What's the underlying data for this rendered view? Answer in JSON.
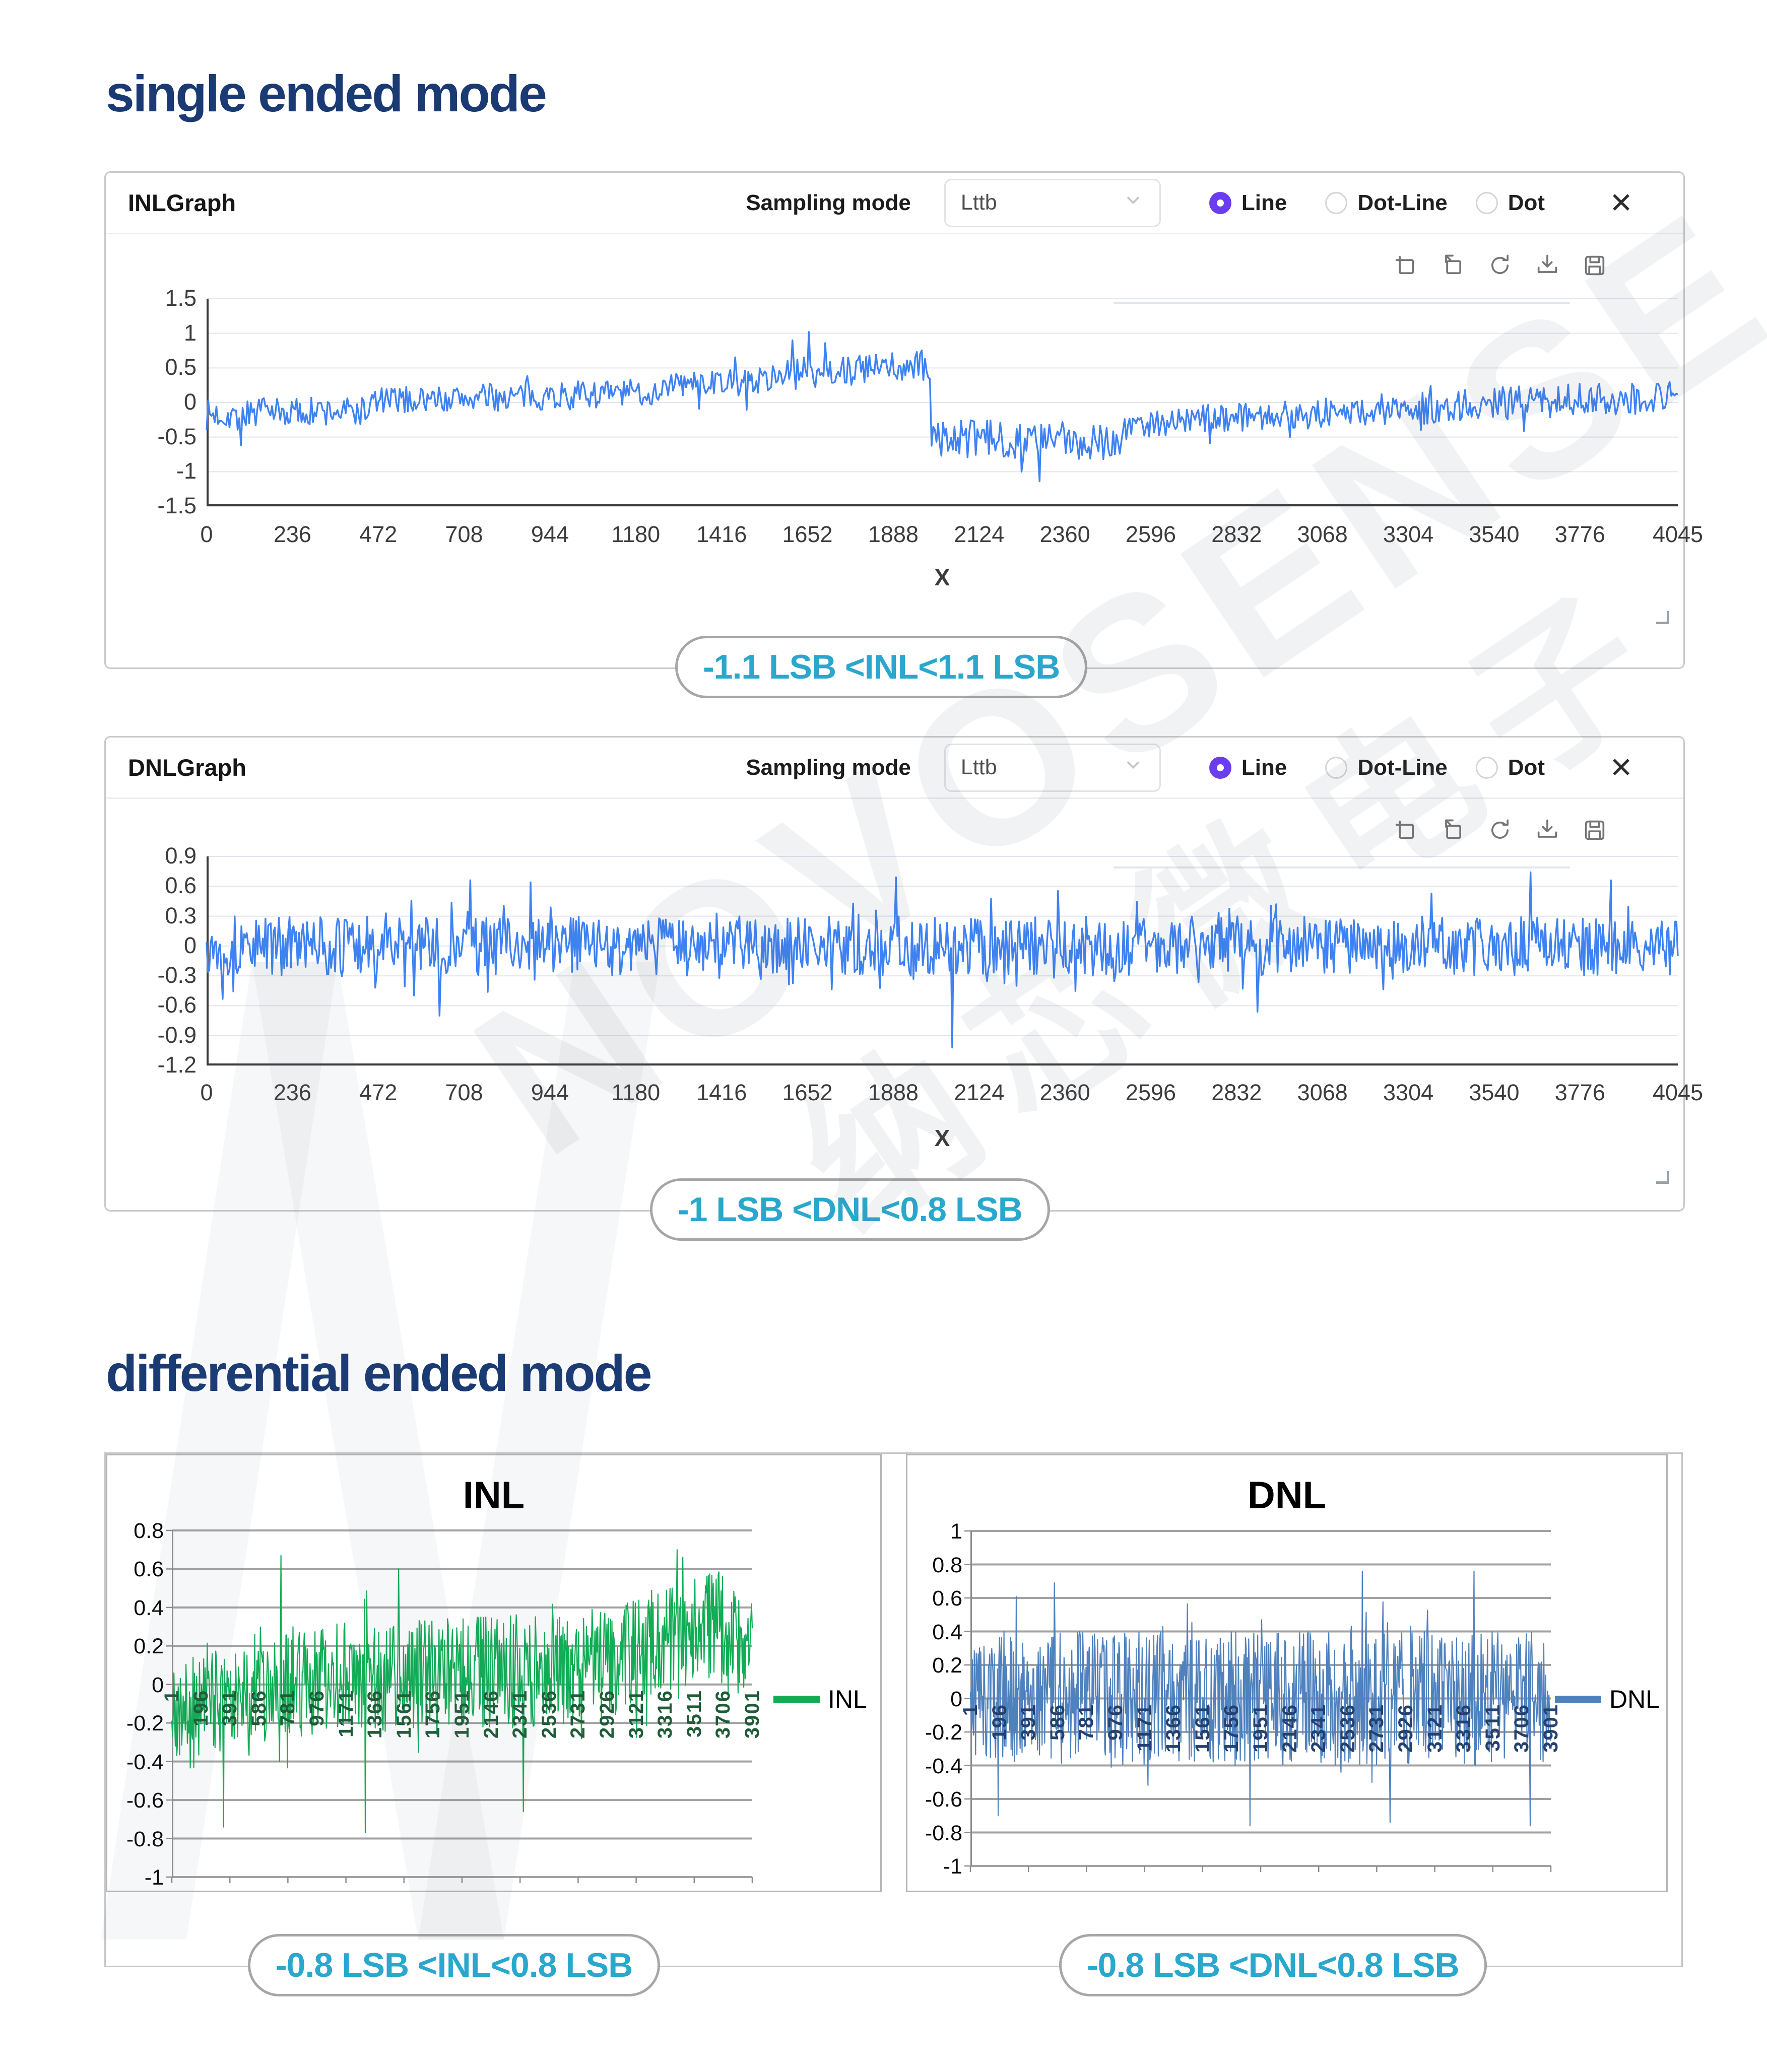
{
  "sections": {
    "single_title": "single ended mode",
    "differential_title": "differential ended mode"
  },
  "colors": {
    "title_navy": "#1a3a74",
    "callout_teal": "#2aa7cd",
    "radio_selected_purple": "#6b3cf0",
    "single_line_blue": "#3e82f2",
    "excel_inl_green": "#10ad55",
    "excel_dnl_blue": "#4f81bd"
  },
  "watermark": {
    "line1": "NOVOSENSE",
    "line2": "纳芯微电子"
  },
  "panels": {
    "inl": {
      "title": "INLGraph",
      "sampling_label": "Sampling mode",
      "sampling_value": "Lttb",
      "radios": [
        {
          "label": "Line",
          "selected": true
        },
        {
          "label": "Dot-Line",
          "selected": false
        },
        {
          "label": "Dot",
          "selected": false
        }
      ],
      "close": "✕",
      "caption": "-1.1 LSB <INL<1.1 LSB"
    },
    "dnl": {
      "title": "DNLGraph",
      "sampling_label": "Sampling mode",
      "sampling_value": "Lttb",
      "radios": [
        {
          "label": "Line",
          "selected": true
        },
        {
          "label": "Dot-Line",
          "selected": false
        },
        {
          "label": "Dot",
          "selected": false
        }
      ],
      "close": "✕",
      "caption": "-1 LSB <DNL<0.8 LSB"
    }
  },
  "excel": {
    "inl_caption": "-0.8 LSB <INL<0.8 LSB",
    "dnl_caption": "-0.8 LSB <DNL<0.8 LSB"
  },
  "chart_data": [
    {
      "id": "inl_single",
      "type": "line",
      "name": "INLGraph (single ended)",
      "x_label": "X",
      "x_max": 4045,
      "x_ticks": [
        "0",
        "236",
        "472",
        "708",
        "944",
        "1180",
        "1416",
        "1652",
        "1888",
        "2124",
        "2360",
        "2596",
        "2832",
        "3068",
        "3304",
        "3540",
        "3776",
        "4045"
      ],
      "y_ticks": [
        "1.5",
        "1",
        "0.5",
        "0",
        "-0.5",
        "-1",
        "-1.5"
      ],
      "ylim": [
        -1.5,
        1.5
      ],
      "color": "#3e82f2",
      "grid": true,
      "range_note": "-1.1 LSB < INL < 1.1 LSB",
      "shape_note": "noise band ~±0.35 around -0.1 for codes 0-1250, rises to ~+0.5 for codes 1550-1990 with peak ≈ +1.05 near 1650, sharp drop after code ~2000 to ≈ -0.55 with minimum ≈ -1.15 near 2290, recovers toward 0 by code 4045",
      "gen": {
        "seed": 7,
        "n": 900,
        "x": [
          0,
          4045
        ],
        "segments": [
          [
            0,
            450,
            -0.18,
            -0.12,
            0.22
          ],
          [
            450,
            1250,
            0.02,
            0.15,
            0.2
          ],
          [
            1250,
            1560,
            0.25,
            0.33,
            0.18
          ],
          [
            1560,
            1990,
            0.42,
            0.52,
            0.24
          ],
          [
            1990,
            2520,
            -0.52,
            -0.55,
            0.28
          ],
          [
            2520,
            2780,
            -0.33,
            -0.22,
            0.2
          ],
          [
            2780,
            3380,
            -0.2,
            -0.1,
            0.22
          ],
          [
            3380,
            4045,
            -0.05,
            0.1,
            0.24
          ]
        ],
        "tail": [
          0.06,
          0.25
        ],
        "clamp": [
          -1.16,
          1.04
        ],
        "spikes": [
          [
            1655,
            1.02
          ],
          [
            1610,
            0.9
          ],
          [
            1700,
            0.86
          ],
          [
            2290,
            -1.14
          ],
          [
            2240,
            -1.0
          ],
          [
            95,
            -0.62
          ]
        ]
      }
    },
    {
      "id": "dnl_single",
      "type": "line",
      "name": "DNLGraph (single ended)",
      "x_label": "X",
      "x_max": 4045,
      "x_ticks": [
        "0",
        "236",
        "472",
        "708",
        "944",
        "1180",
        "1416",
        "1652",
        "1888",
        "2124",
        "2360",
        "2596",
        "2832",
        "3068",
        "3304",
        "3540",
        "3776",
        "4045"
      ],
      "y_ticks": [
        "0.9",
        "0.6",
        "0.3",
        "0",
        "-0.3",
        "-0.6",
        "-0.9",
        "-1.2"
      ],
      "ylim": [
        -1.2,
        0.9
      ],
      "color": "#3e82f2",
      "grid": true,
      "range_note": "-1 LSB < DNL < 0.8 LSB",
      "shape_note": "uniform noise ±0.35 around 0 with spikes to +0.75 and one dip ≈ -1.0 near code 2050",
      "gen": {
        "seed": 13,
        "n": 1100,
        "x": [
          0,
          4045
        ],
        "segments": [
          [
            0,
            4045,
            0,
            0,
            0.3
          ]
        ],
        "tail": [
          0.15,
          0.28
        ],
        "clamp": [
          -1.03,
          0.74
        ],
        "spikes": [
          [
            2050,
            -1.02
          ],
          [
            725,
            0.66
          ],
          [
            640,
            -0.7
          ],
          [
            1895,
            0.69
          ],
          [
            3640,
            0.74
          ],
          [
            3860,
            0.66
          ],
          [
            890,
            0.64
          ],
          [
            2890,
            -0.66
          ]
        ]
      }
    },
    {
      "id": "inl_diff",
      "type": "line",
      "title": "INL",
      "legend": "INL",
      "name": "INL (differential ended)",
      "x_categories": [
        "1",
        "196",
        "391",
        "586",
        "781",
        "976",
        "1171",
        "1366",
        "1561",
        "1756",
        "1951",
        "2146",
        "2341",
        "2536",
        "2731",
        "2926",
        "3121",
        "3316",
        "3511",
        "3706",
        "3901"
      ],
      "y_ticks": [
        "0.8",
        "0.6",
        "0.4",
        "0.2",
        "0",
        "-0.2",
        "-0.4",
        "-0.6",
        "-0.8",
        "-1"
      ],
      "ylim": [
        -1,
        0.8
      ],
      "color": "#10ad55",
      "cat_color": "#1e5c38",
      "grid": true,
      "legend_position": "right",
      "range_note": "-0.8 LSB < INL < 0.8 LSB",
      "shape_note": "dense noise mass between ≈ -0.65 and +0.55, mean rising slightly left to right, elevated to ≈ +0.7 near codes 3500-3900, occasional dips to ≈ -0.77",
      "gen": {
        "seed": 21,
        "n": 820,
        "x": [
          1,
          4045
        ],
        "segments": [
          [
            1,
            550,
            -0.15,
            -0.05,
            0.28
          ],
          [
            550,
            1500,
            0.0,
            0.05,
            0.3
          ],
          [
            1500,
            2600,
            0.02,
            0.08,
            0.3
          ],
          [
            2600,
            3300,
            0.05,
            0.18,
            0.3
          ],
          [
            3300,
            3800,
            0.2,
            0.32,
            0.28
          ],
          [
            3800,
            4045,
            0.3,
            0.15,
            0.3
          ]
        ],
        "tail": [
          0.08,
          0.22
        ],
        "clamp": [
          -0.77,
          0.7
        ],
        "spikes": [
          [
            360,
            -0.74
          ],
          [
            1350,
            -0.77
          ],
          [
            760,
            0.67
          ],
          [
            1580,
            0.6
          ],
          [
            2450,
            -0.66
          ],
          [
            3520,
            0.7
          ],
          [
            3560,
            0.66
          ]
        ]
      }
    },
    {
      "id": "dnl_diff",
      "type": "line",
      "title": "DNL",
      "legend": "DNL",
      "name": "DNL (differential ended)",
      "x_categories": [
        "1",
        "196",
        "391",
        "586",
        "781",
        "976",
        "1171",
        "1366",
        "1561",
        "1756",
        "1951",
        "2146",
        "2341",
        "2536",
        "2731",
        "2926",
        "3121",
        "3316",
        "3511",
        "3706",
        "3901"
      ],
      "y_ticks": [
        "1",
        "0.8",
        "0.6",
        "0.4",
        "0.2",
        "0",
        "-0.2",
        "-0.4",
        "-0.6",
        "-0.8",
        "-1"
      ],
      "ylim": [
        -1,
        1
      ],
      "color": "#4f81bd",
      "cat_color": "#24406e",
      "grid": true,
      "legend_position": "right",
      "range_note": "-0.8 LSB < DNL < 0.8 LSB",
      "shape_note": "uniform dense noise mass ≈ ±0.5 around 0 with spikes to ±0.77",
      "gen": {
        "seed": 33,
        "n": 900,
        "x": [
          1,
          4045
        ],
        "segments": [
          [
            1,
            4045,
            0,
            0,
            0.4
          ]
        ],
        "tail": [
          0.12,
          0.24
        ],
        "clamp": [
          -0.77,
          0.76
        ],
        "spikes": [
          [
            1951,
            -0.76
          ],
          [
            2926,
            -0.74
          ],
          [
            3901,
            -0.76
          ],
          [
            2731,
            0.76
          ],
          [
            3511,
            0.76
          ],
          [
            586,
            0.69
          ],
          [
            196,
            -0.7
          ]
        ]
      }
    }
  ]
}
